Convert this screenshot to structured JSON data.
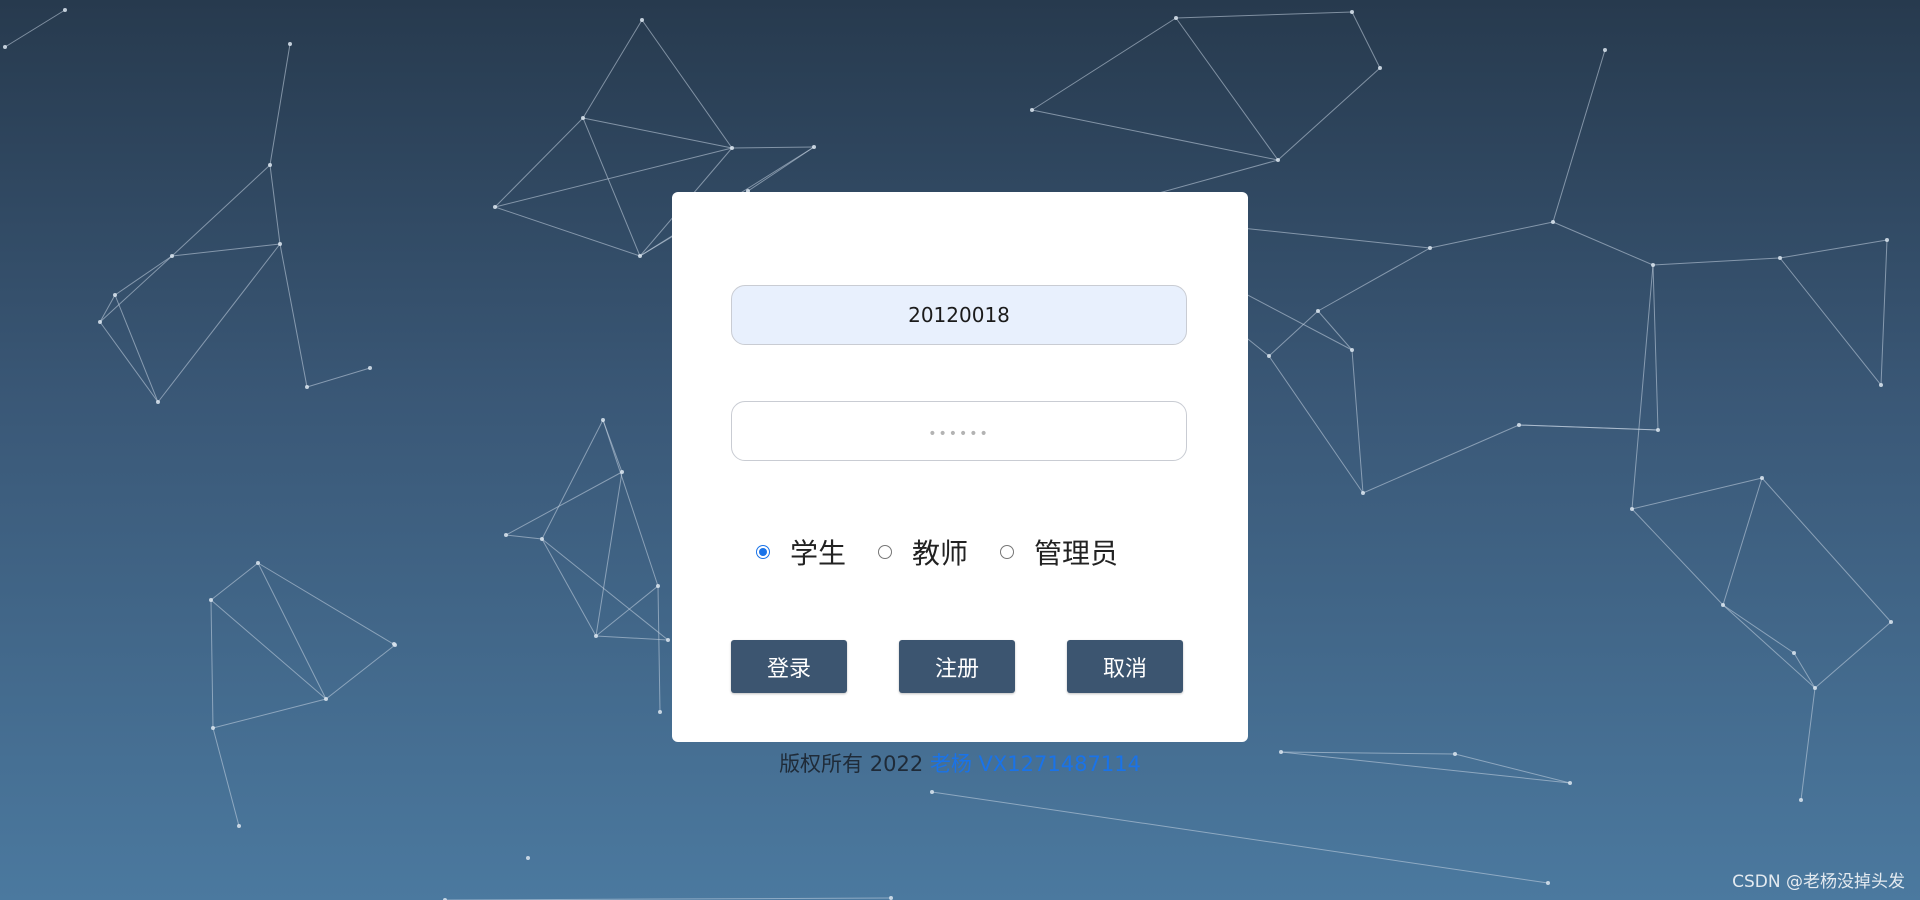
{
  "login": {
    "username_value": "20120018",
    "password_placeholder": "••••••",
    "roles": [
      {
        "label": "学生",
        "checked": true
      },
      {
        "label": "教师",
        "checked": false
      },
      {
        "label": "管理员",
        "checked": false
      }
    ],
    "buttons": {
      "login": "登录",
      "register": "注册",
      "cancel": "取消"
    }
  },
  "footer": {
    "copyright": "版权所有 2022",
    "contact": "老杨 VX1271487114"
  },
  "watermark": "CSDN @老杨没掉头发",
  "colors": {
    "button_bg": "#3c5570",
    "accent": "#1a73e8",
    "input_fill": "#e8f0fd"
  }
}
